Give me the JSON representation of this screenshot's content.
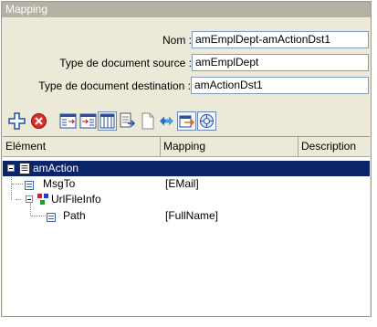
{
  "panel": {
    "title": "Mapping"
  },
  "form": {
    "name_label": "Nom :",
    "name_value": "amEmplDept-amActionDst1",
    "source_label": "Type de document source :",
    "source_value": "amEmplDept",
    "dest_label": "Type de document destination :",
    "dest_value": "amActionDst1"
  },
  "toolbar": {
    "icons": [
      "add-icon",
      "delete-icon",
      "map-left-icon",
      "map-right-icon",
      "columns-icon",
      "document-export-icon",
      "blank-page-icon",
      "swap-arrows-icon",
      "export-selected-icon",
      "auto-map-icon"
    ]
  },
  "grid": {
    "columns": [
      "Elément",
      "Mapping",
      "Description"
    ],
    "rows": [
      {
        "element": "amAction",
        "mapping": "",
        "selected": true
      },
      {
        "element": "MsgTo",
        "mapping": "[EMail]",
        "selected": false
      },
      {
        "element": "UrlFileInfo",
        "mapping": "",
        "selected": false
      },
      {
        "element": "Path",
        "mapping": "[FullName]",
        "selected": false
      }
    ]
  },
  "colors": {
    "selection": "#0a246a",
    "title_bar": "#b5b2a3",
    "panel_bg": "#ece9d8"
  }
}
